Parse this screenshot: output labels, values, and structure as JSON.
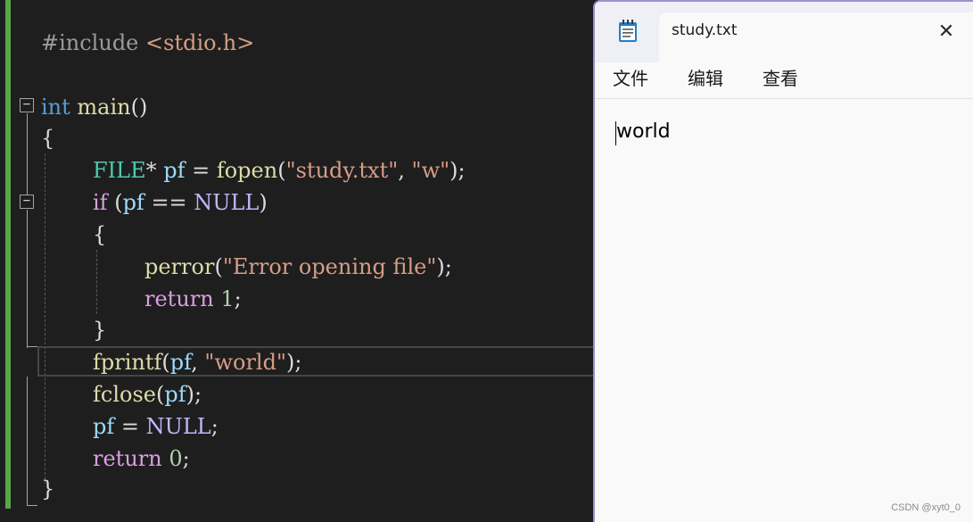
{
  "editor": {
    "tokens": {
      "l1_a": "#include",
      "l1_b": " <stdio.h>",
      "l3_a": "int",
      "l3_b": " main",
      "l3_c": "()",
      "l4_a": "{",
      "l5_a": "FILE",
      "l5_b": "*",
      "l5_c": " pf",
      "l5_d": " = ",
      "l5_e": "fopen",
      "l5_f": "(",
      "l5_g": "\"study.txt\"",
      "l5_h": ", ",
      "l5_i": "\"w\"",
      "l5_j": ");",
      "l6_a": "if",
      "l6_b": " (",
      "l6_c": "pf",
      "l6_d": " == ",
      "l6_e": "NULL",
      "l6_f": ")",
      "l7_a": "{",
      "l8_a": "perror",
      "l8_b": "(",
      "l8_c": "\"Error opening file\"",
      "l8_d": ");",
      "l9_a": "return",
      "l9_b": " 1",
      "l9_c": ";",
      "l10_a": "}",
      "l11_a": "fprintf",
      "l11_b": "(",
      "l11_c": "pf",
      "l11_d": ", ",
      "l11_e": "\"world\"",
      "l11_f": ");",
      "l12_a": "fclose",
      "l12_b": "(",
      "l12_c": "pf",
      "l12_d": ");",
      "l13_a": "pf",
      "l13_b": " = ",
      "l13_c": "NULL",
      "l13_d": ";",
      "l14_a": "return",
      "l14_b": " 0",
      "l14_c": ";",
      "l15_a": "}"
    },
    "fold_glyph": "−"
  },
  "notepad": {
    "tab_title": "study.txt",
    "close_glyph": "✕",
    "menu": [
      "文件",
      "编辑",
      "查看"
    ],
    "content": "world"
  },
  "watermark": "CSDN @xyt0_0",
  "colors": {
    "editor_bg": "#1e1e1e",
    "change_bar": "#57a64a",
    "keyword": "#569cd6",
    "control": "#d8a0df",
    "function": "#dcdcaa",
    "type": "#4ec9b0",
    "variable": "#9cdcfe",
    "string": "#d69d85",
    "number": "#b5cea8",
    "macro": "#beb7ff",
    "notepad_border": "#9f8fd0"
  },
  "icons": {
    "notepad": "notepad-icon",
    "close": "close-icon",
    "fold": "collapse-icon"
  }
}
